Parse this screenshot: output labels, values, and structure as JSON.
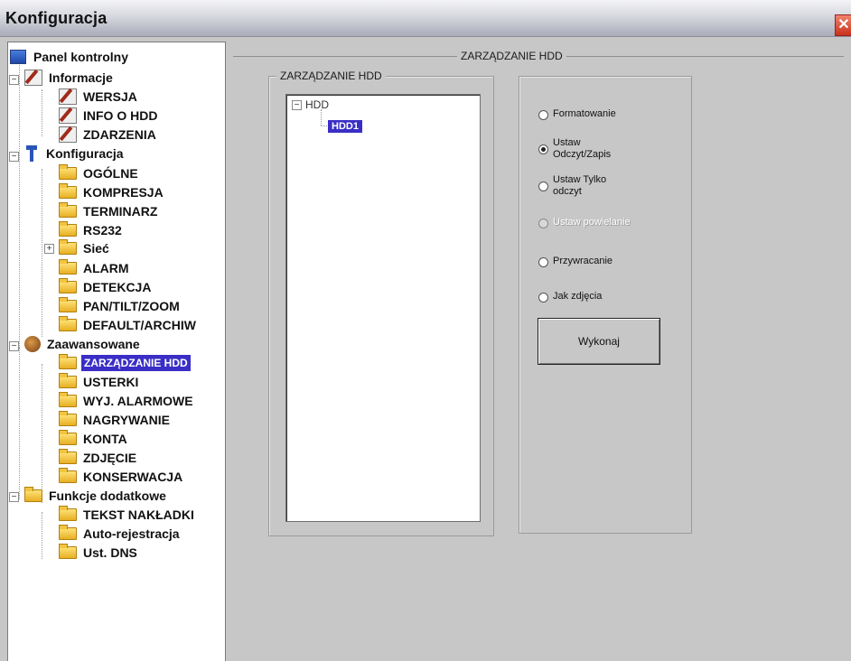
{
  "window": {
    "title": "Konfiguracja",
    "close_symbol": "✕"
  },
  "tree": {
    "panel": "Panel kontrolny",
    "informacje": "Informacje",
    "wersja": "WERSJA",
    "info_hdd": "INFO O HDD",
    "zdarzenia": "ZDARZENIA",
    "konfiguracja": "Konfiguracja",
    "ogolne": "OGÓLNE",
    "kompresja": "KOMPRESJA",
    "terminarz": "TERMINARZ",
    "rs232": "RS232",
    "siec": "Sieć",
    "alarm": "ALARM",
    "detekcja": "DETEKCJA",
    "ptz": "PAN/TILT/ZOOM",
    "default": "DEFAULT/ARCHIW",
    "zaawansowane": "Zaawansowane",
    "zarzadzanie_hdd": "ZARZĄDZANIE HDD",
    "usterki": "USTERKI",
    "wyj_alarmowe": "WYJ. ALARMOWE",
    "nagrywanie": "NAGRYWANIE",
    "konta": "KONTA",
    "zdjecie": "ZDJĘCIE",
    "konserwacja": "KONSERWACJA",
    "funkcje": "Funkcje dodatkowe",
    "tekst": "TEKST NAKŁADKI",
    "autorejestracja": "Auto-rejestracja",
    "dns": "Ust. DNS"
  },
  "main": {
    "section_title": "ZARZĄDZANIE HDD",
    "group_title": "ZARZĄDZANIE HDD",
    "hdd_root": "HDD",
    "hdd1": "HDD1",
    "options": {
      "format": "Formatowanie",
      "rw_line1": "Ustaw",
      "rw_line2": "Odczyt/Zapis",
      "ro_line1": "Ustaw Tylko",
      "ro_line2": "odczyt",
      "redundant": "Ustaw powielanie",
      "restore": "Przywracanie",
      "snapshot": "Jak zdjęcia"
    },
    "selected_option": "rw",
    "execute_label": "Wykonaj"
  }
}
